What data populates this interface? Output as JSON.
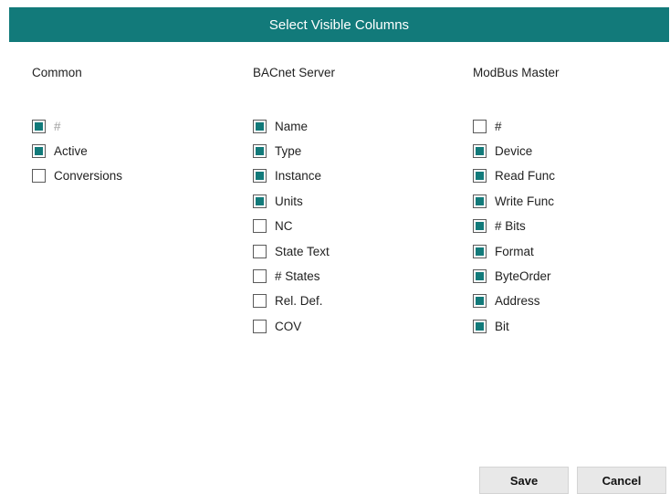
{
  "dialog": {
    "title": "Select Visible Columns"
  },
  "columns": [
    {
      "header": "Common",
      "items": [
        {
          "label": "#",
          "checked": true,
          "dimmed": true
        },
        {
          "label": "Active",
          "checked": true
        },
        {
          "label": "Conversions",
          "checked": false
        }
      ]
    },
    {
      "header": "BACnet Server",
      "items": [
        {
          "label": "Name",
          "checked": true
        },
        {
          "label": "Type",
          "checked": true
        },
        {
          "label": "Instance",
          "checked": true
        },
        {
          "label": "Units",
          "checked": true
        },
        {
          "label": "NC",
          "checked": false
        },
        {
          "label": "State Text",
          "checked": false
        },
        {
          "label": "# States",
          "checked": false
        },
        {
          "label": "Rel. Def.",
          "checked": false
        },
        {
          "label": "COV",
          "checked": false
        }
      ]
    },
    {
      "header": "ModBus Master",
      "items": [
        {
          "label": "#",
          "checked": false
        },
        {
          "label": "Device",
          "checked": true
        },
        {
          "label": "Read Func",
          "checked": true
        },
        {
          "label": "Write Func",
          "checked": true
        },
        {
          "label": "# Bits",
          "checked": true
        },
        {
          "label": "Format",
          "checked": true
        },
        {
          "label": "ByteOrder",
          "checked": true
        },
        {
          "label": "Address",
          "checked": true
        },
        {
          "label": "Bit",
          "checked": true
        }
      ]
    }
  ],
  "buttons": {
    "save": "Save",
    "cancel": "Cancel"
  },
  "colors": {
    "accent": "#127a7a"
  }
}
